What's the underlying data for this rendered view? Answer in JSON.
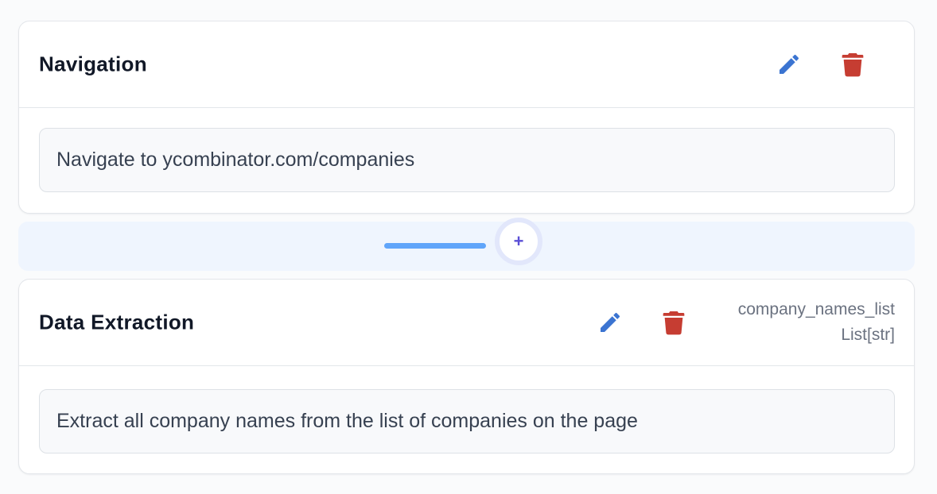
{
  "colors": {
    "edit_icon": "#3b74d1",
    "delete_icon": "#c63d32",
    "insert_line": "#60a5fa",
    "insert_zone": "#eff5fe",
    "insert_plus": "#5b4fd6"
  },
  "steps": [
    {
      "title": "Navigation",
      "description": "Navigate to ycombinator.com/companies",
      "edit_icon": "pencil-icon",
      "delete_icon": "trash-icon"
    },
    {
      "title": "Data Extraction",
      "description": "Extract all company names from the list of companies on the page",
      "edit_icon": "pencil-icon",
      "delete_icon": "trash-icon",
      "output": {
        "name": "company_names_list",
        "type": "List[str]"
      }
    }
  ],
  "insert": {
    "label": "+"
  }
}
